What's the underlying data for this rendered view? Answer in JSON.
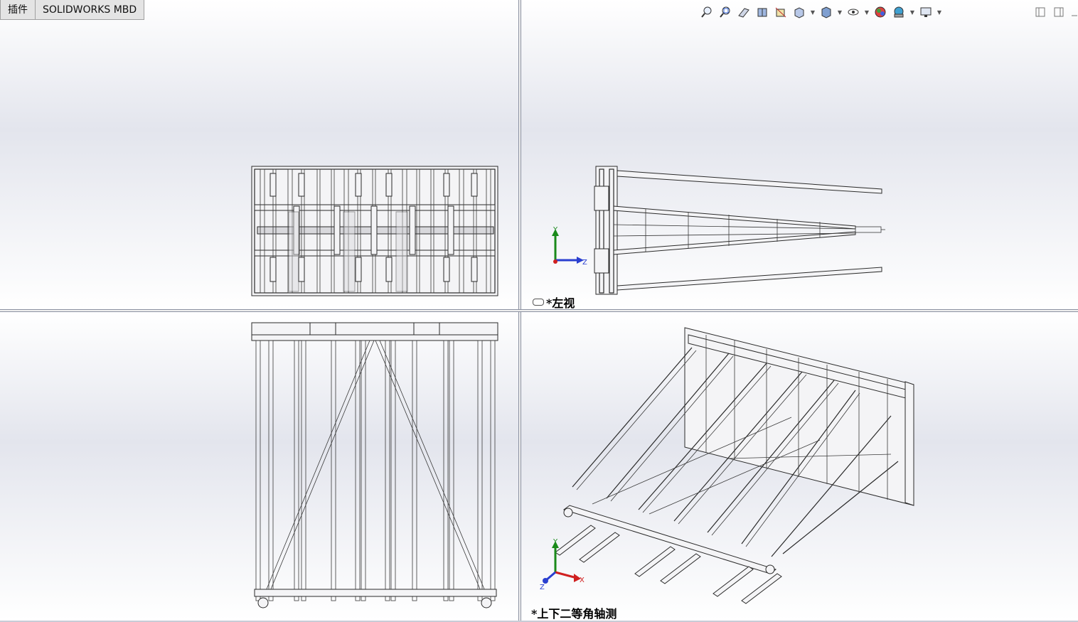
{
  "tabs": [
    {
      "label": "插件"
    },
    {
      "label": "SOLIDWORKS MBD"
    }
  ],
  "heads_up_toolbar": {
    "icons": [
      "zoom-to-fit-icon",
      "zoom-to-area-icon",
      "previous-view-icon",
      "section-view-icon",
      "dynamic-annotation-icon",
      "view-orientation-icon",
      "display-style-icon",
      "hide-show-items-icon",
      "edit-appearance-icon",
      "apply-scene-icon",
      "view-settings-icon"
    ]
  },
  "viewports": {
    "top_left": {
      "label": ""
    },
    "top_right": {
      "label": "*左视",
      "triad": {
        "y": "Y",
        "z": "Z"
      }
    },
    "bottom_left": {
      "label": ""
    },
    "bottom_right": {
      "label": "*上下二等角轴测",
      "triad": {
        "y": "Y",
        "x": "X",
        "z": "Z"
      }
    }
  },
  "colors": {
    "triad_y": "#1a8a1a",
    "triad_z": "#2a3fd0",
    "triad_x": "#d02020",
    "model_lines": "#2a2a2a",
    "viewport_mid": "#e3e5ed"
  }
}
